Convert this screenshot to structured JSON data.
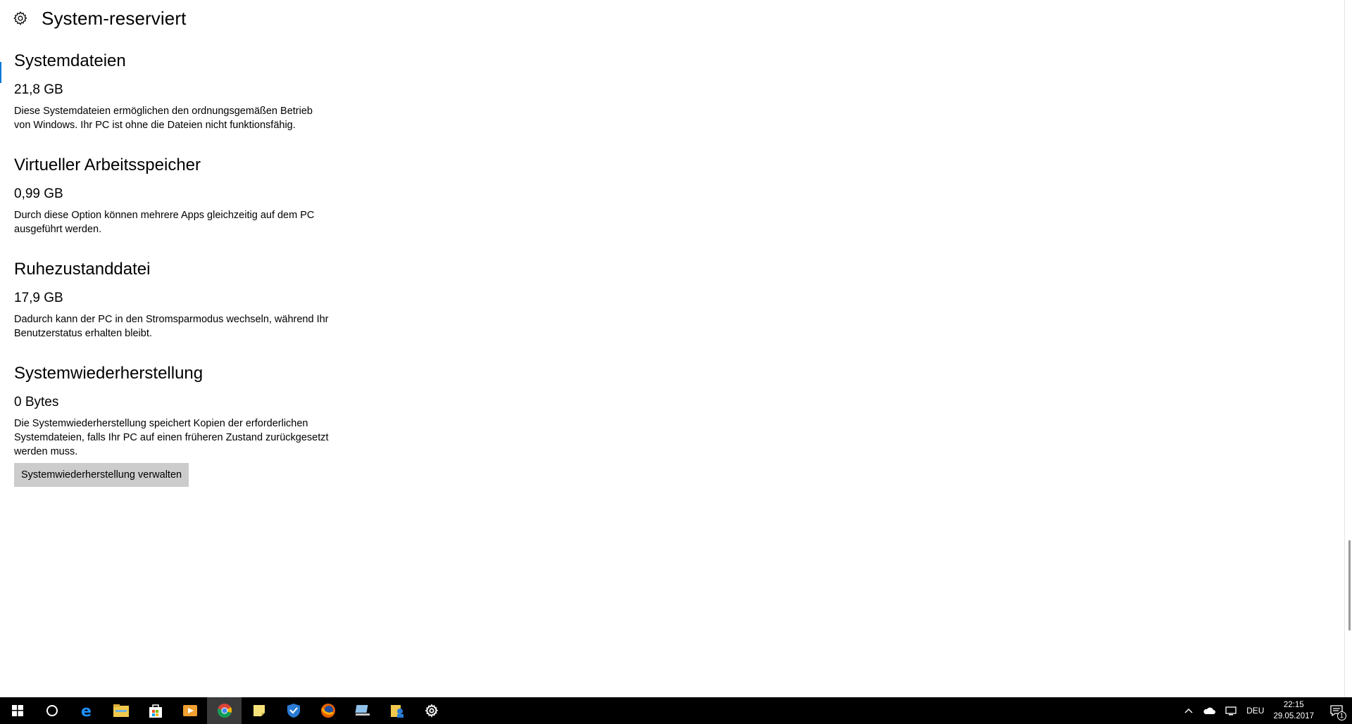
{
  "header": {
    "title": "System-reserviert",
    "icon": "gear-icon"
  },
  "sections": [
    {
      "title": "Systemdateien",
      "size": "21,8 GB",
      "description": "Diese Systemdateien ermöglichen den ordnungsgemäßen Betrieb von Windows. Ihr PC ist ohne die Dateien nicht funktionsfähig."
    },
    {
      "title": "Virtueller Arbeitsspeicher",
      "size": "0,99 GB",
      "description": "Durch diese Option können mehrere Apps gleichzeitig auf dem PC ausgeführt werden."
    },
    {
      "title": "Ruhezustanddatei",
      "size": "17,9 GB",
      "description": "Dadurch kann der PC in den Stromsparmodus wechseln, während Ihr Benutzerstatus erhalten bleibt."
    },
    {
      "title": "Systemwiederherstellung",
      "size": "0 Bytes",
      "description": "Die Systemwiederherstellung speichert Kopien der erforderlichen Systemdateien, falls Ihr PC auf einen früheren Zustand zurückgesetzt werden muss.",
      "button_label": "Systemwiederherstellung verwalten"
    }
  ],
  "taskbar": {
    "icons": [
      "windows-start-icon",
      "cortana-icon",
      "edge-icon",
      "file-explorer-icon",
      "store-icon",
      "media-player-icon",
      "chrome-icon",
      "sticky-notes-icon",
      "shield-app-icon",
      "firefox-icon",
      "pc-tool-icon",
      "contacts-icon",
      "settings-gear-icon"
    ],
    "language": "DEU",
    "time": "22:15",
    "date": "29.05.2017",
    "notification_count": "1"
  },
  "colors": {
    "accent": "#0078d7",
    "button_bg": "#cccccc",
    "taskbar_bg": "#000000"
  }
}
